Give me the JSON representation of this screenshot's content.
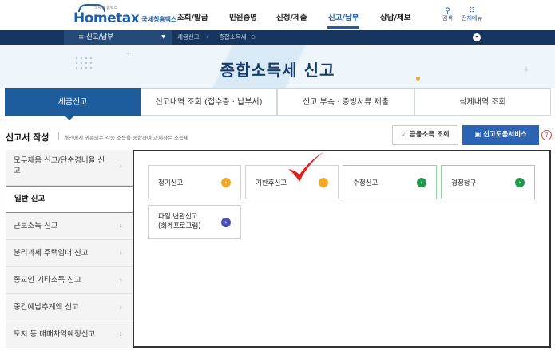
{
  "header": {
    "logo_text": "Hometax",
    "logo_sub": "국세청홈택스",
    "logo_tiny": "국세청 홈택스",
    "nav": [
      "조회/발급",
      "민원증명",
      "신청/제출",
      "신고/납부",
      "상담/제보"
    ],
    "active_nav": "신고/납부",
    "util": [
      {
        "icon": "search-icon",
        "label": "검색"
      },
      {
        "icon": "grid-icon",
        "label": "전체메뉴"
      }
    ]
  },
  "navbar": {
    "menu_label": "≡ 신고/납부",
    "crumbs": [
      "세금신고",
      "종합소득세"
    ]
  },
  "banner": {
    "title": "종합소득세 신고"
  },
  "tabs": [
    {
      "label": "세금신고",
      "active": true
    },
    {
      "label": "신고내역 조회 (접수증 · 납부서)",
      "active": false
    },
    {
      "label": "신고 부속 · 증빙서류 제출",
      "active": false
    },
    {
      "label": "삭제내역 조회",
      "active": false
    }
  ],
  "section": {
    "title": "신고서 작성",
    "desc": "개인에게 귀속되는 각종 소득을 종합하여 과세하는 소득세",
    "fin_button": "금융소득 조회",
    "help_button": "신고도움서비스",
    "help_icon": "question-icon"
  },
  "side_menu": [
    {
      "label": "모두채움 신고/단순경비율 신고",
      "active": false
    },
    {
      "label": "일반 신고",
      "active": true
    },
    {
      "label": "근로소득 신고",
      "active": false
    },
    {
      "label": "분리과세 주택임대 신고",
      "active": false
    },
    {
      "label": "종교인 기타소득 신고",
      "active": false
    },
    {
      "label": "중간예납추계액 신고",
      "active": false
    },
    {
      "label": "토지 등 매매차익예정신고",
      "active": false
    }
  ],
  "cards": [
    {
      "label": "정기신고",
      "color": "#f5a623"
    },
    {
      "label": "기한후신고",
      "color": "#f5a623"
    },
    {
      "label": "수정신고",
      "color": "#1f9a4a"
    },
    {
      "label": "경정청구",
      "color": "#1f9a4a"
    },
    {
      "label_line1": "파일 변환신고",
      "label_line2": "(회계프로그램)",
      "color": "#4a52b8"
    }
  ],
  "colors": {
    "brand_blue": "#1d5c9c",
    "nav_dark": "#17365f",
    "help_button": "#2b63b5",
    "check_mark": "#e11d1d"
  }
}
